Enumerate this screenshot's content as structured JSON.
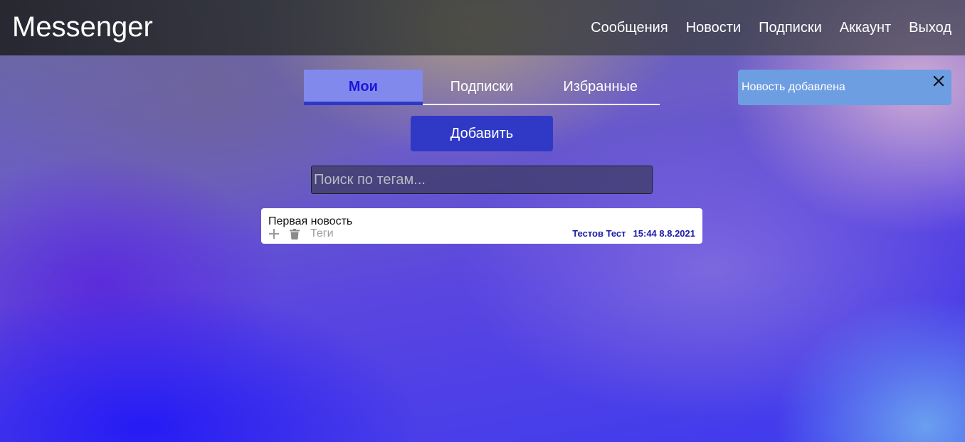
{
  "header": {
    "brand": "Messenger",
    "nav": [
      "Сообщения",
      "Новости",
      "Подписки",
      "Аккаунт",
      "Выход"
    ]
  },
  "tabs": {
    "items": [
      "Мои",
      "Подписки",
      "Избранные"
    ],
    "active": "Мои"
  },
  "actions": {
    "add_label": "Добавить"
  },
  "search": {
    "placeholder": "Поиск по тегам...",
    "value": ""
  },
  "news": [
    {
      "title": "Первая новость",
      "tags_label": "Теги",
      "author": "Тестов Тест",
      "datetime": "15:44 8.8.2021",
      "icons": [
        "plus-icon",
        "trash-icon"
      ]
    }
  ],
  "toast": {
    "message": "Новость добавлена",
    "icon": "close-icon"
  },
  "colors": {
    "accent": "#2f39c6",
    "active_tab_bg": "#8289ec",
    "active_tab_text": "#1a18d8",
    "toast_bg": "#6d9ee2",
    "meta_text": "#1a1aa8"
  }
}
